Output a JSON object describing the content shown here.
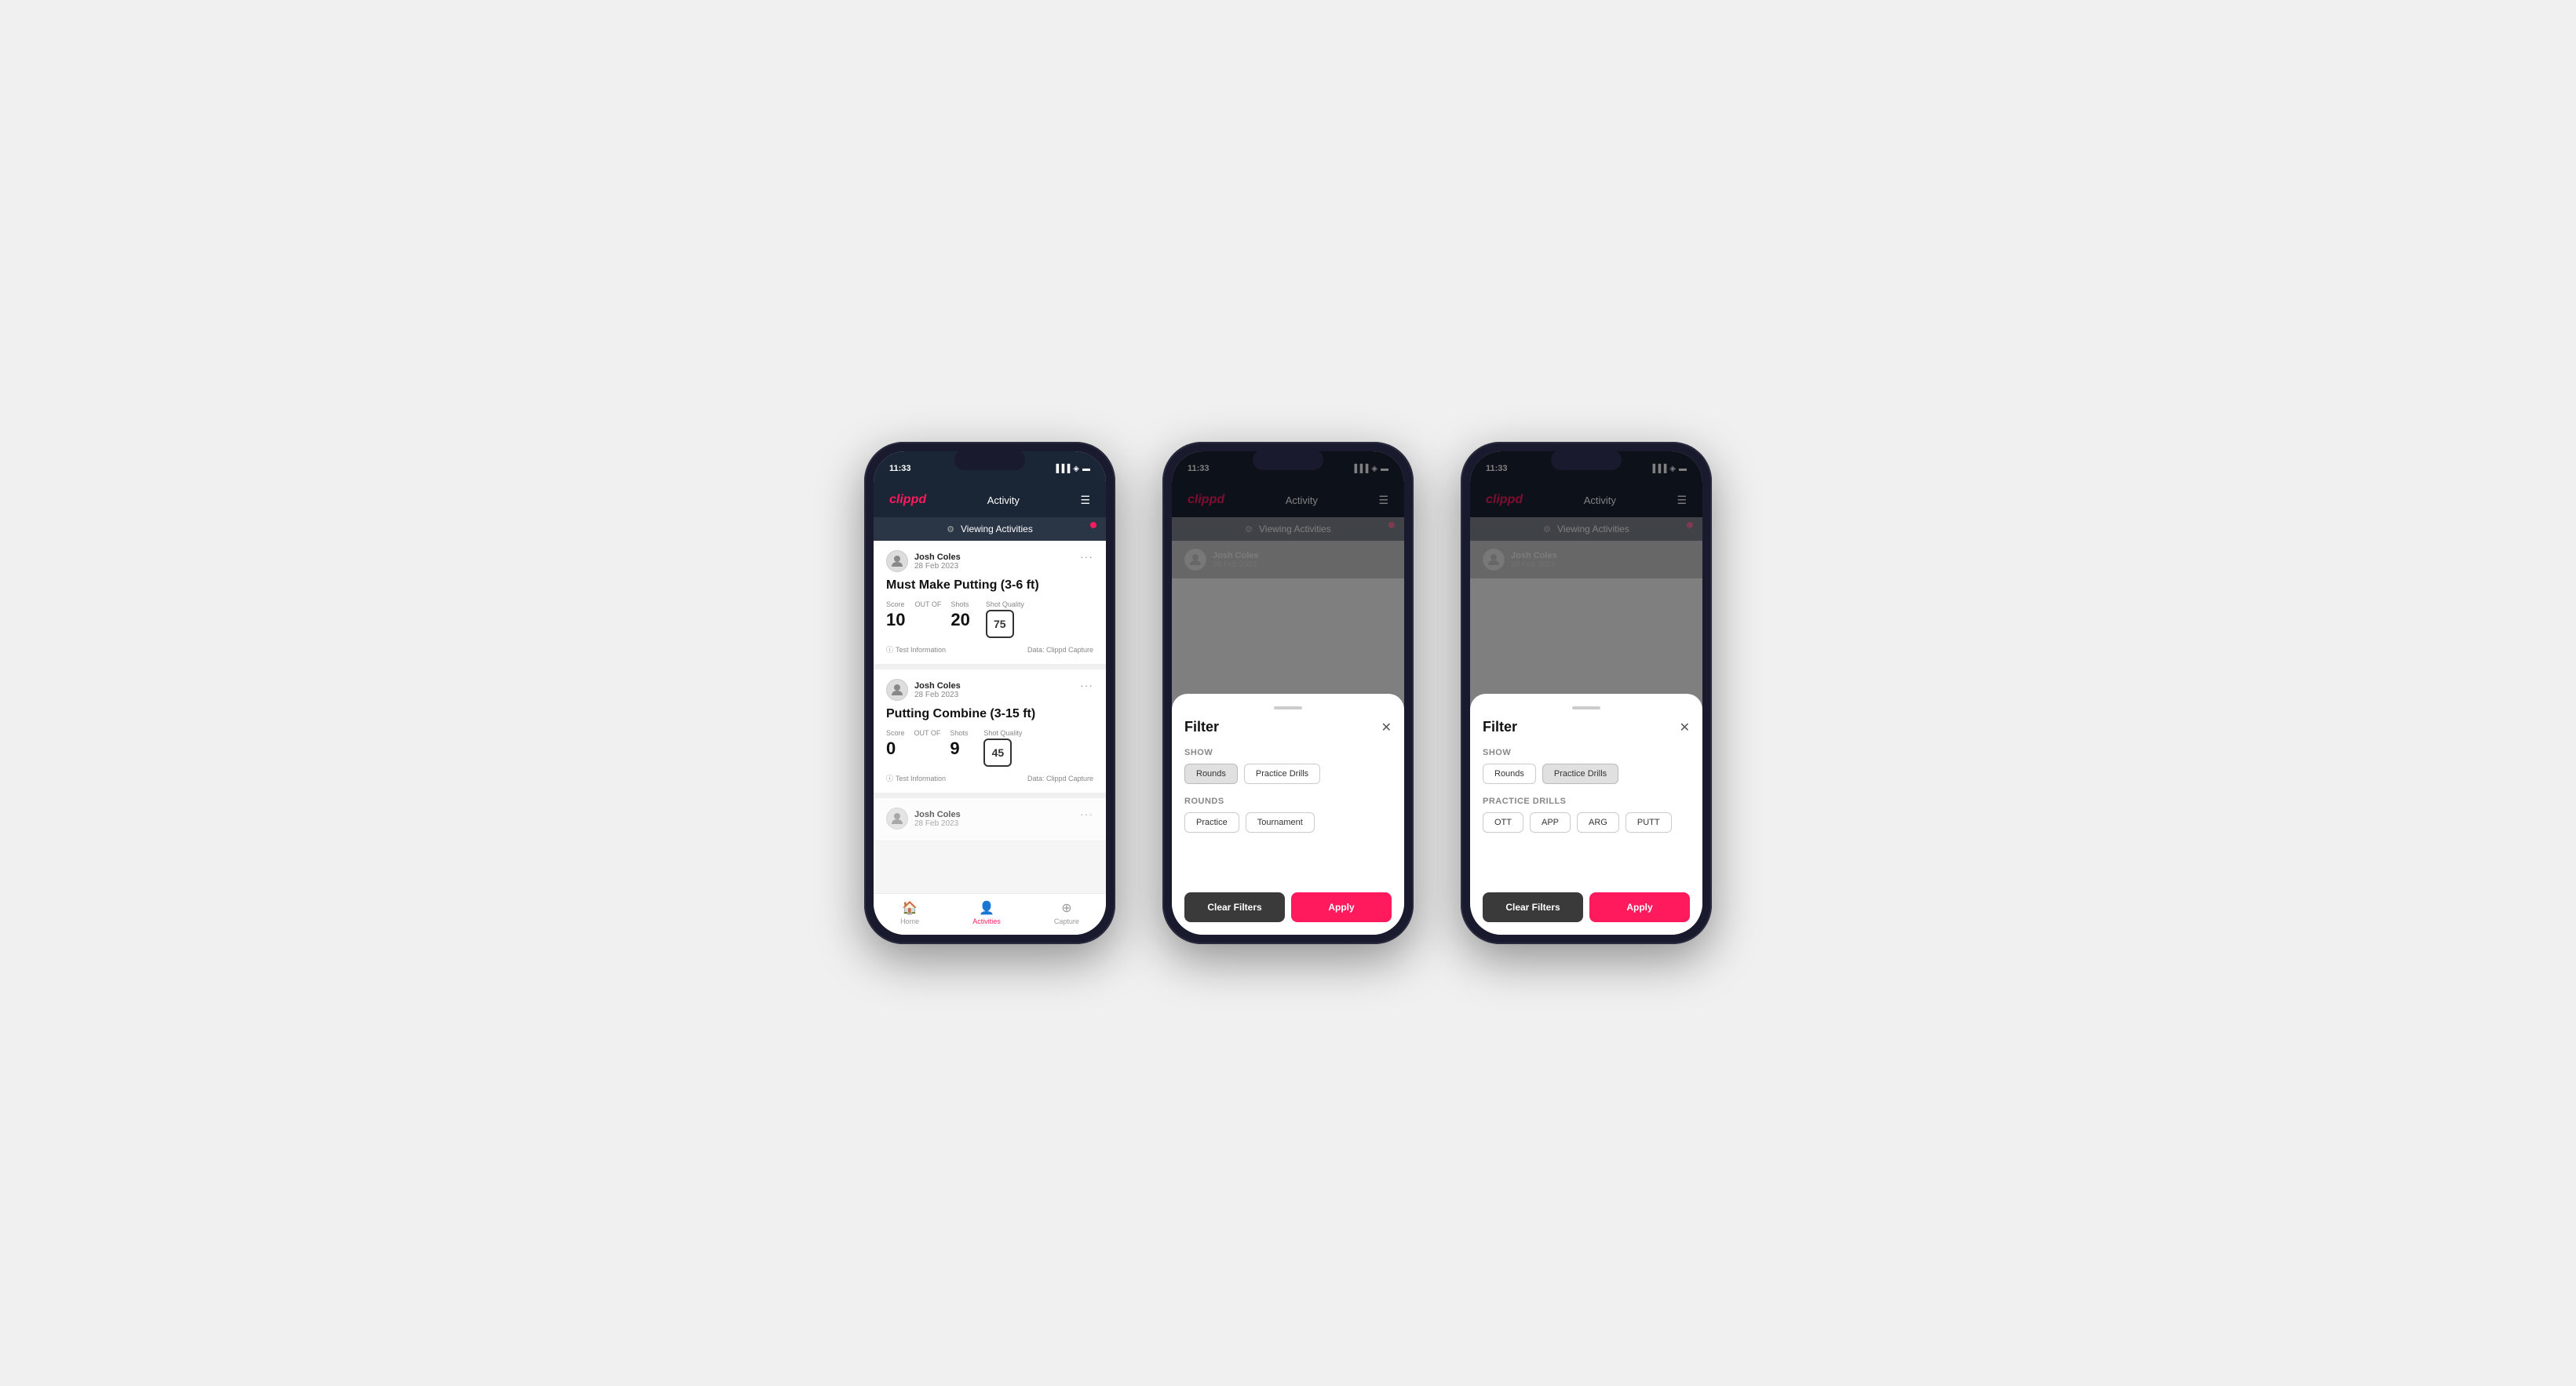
{
  "app": {
    "name": "clippd",
    "title": "Activity",
    "time": "11:33"
  },
  "phone1": {
    "viewing_bar": "Viewing Activities",
    "cards": [
      {
        "user": "Josh Coles",
        "date": "28 Feb 2023",
        "title": "Must Make Putting (3-6 ft)",
        "score_label": "Score",
        "shots_label": "Shots",
        "quality_label": "Shot Quality",
        "score": "10",
        "out_of": "OUT OF",
        "shots": "20",
        "quality": "75",
        "info": "Test Information",
        "data_source": "Data: Clippd Capture"
      },
      {
        "user": "Josh Coles",
        "date": "28 Feb 2023",
        "title": "Putting Combine (3-15 ft)",
        "score_label": "Score",
        "shots_label": "Shots",
        "quality_label": "Shot Quality",
        "score": "0",
        "out_of": "OUT OF",
        "shots": "9",
        "quality": "45",
        "info": "Test Information",
        "data_source": "Data: Clippd Capture"
      },
      {
        "user": "Josh Coles",
        "date": "28 Feb 2023"
      }
    ],
    "bottom_nav": [
      {
        "label": "Home",
        "icon": "🏠",
        "active": false
      },
      {
        "label": "Activities",
        "icon": "👤",
        "active": true
      },
      {
        "label": "Capture",
        "icon": "➕",
        "active": false
      }
    ]
  },
  "phone2": {
    "viewing_bar": "Viewing Activities",
    "filter": {
      "title": "Filter",
      "show_label": "Show",
      "rounds_label": "Rounds",
      "show_chips": [
        {
          "label": "Rounds",
          "selected": true
        },
        {
          "label": "Practice Drills",
          "selected": false
        }
      ],
      "rounds_chips": [
        {
          "label": "Practice",
          "selected": false
        },
        {
          "label": "Tournament",
          "selected": false
        }
      ],
      "clear_btn": "Clear Filters",
      "apply_btn": "Apply"
    }
  },
  "phone3": {
    "viewing_bar": "Viewing Activities",
    "filter": {
      "title": "Filter",
      "show_label": "Show",
      "practice_drills_label": "Practice Drills",
      "show_chips": [
        {
          "label": "Rounds",
          "selected": false
        },
        {
          "label": "Practice Drills",
          "selected": true
        }
      ],
      "practice_chips": [
        {
          "label": "OTT",
          "selected": false
        },
        {
          "label": "APP",
          "selected": false
        },
        {
          "label": "ARG",
          "selected": false
        },
        {
          "label": "PUTT",
          "selected": false
        }
      ],
      "clear_btn": "Clear Filters",
      "apply_btn": "Apply"
    }
  }
}
